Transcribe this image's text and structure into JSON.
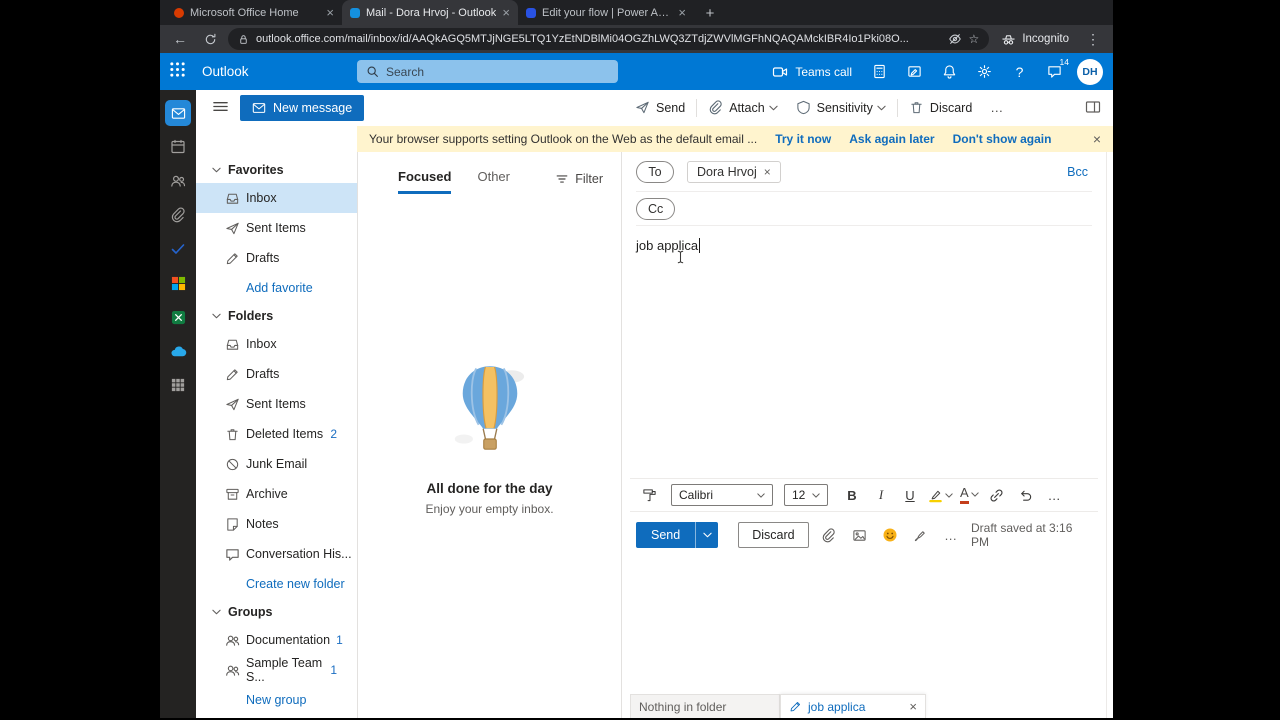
{
  "theme": {
    "accent": "#0078d4",
    "header_bg": "#0078d4",
    "banner_bg": "#fff4ce",
    "selected_row_bg": "#cde4f7",
    "chrome_bg": "#202124",
    "chrome_toolbar_bg": "#35363a",
    "rail_bg": "#242322",
    "link_blue": "#0f6cbd"
  },
  "glyphs": {
    "close": "×",
    "plus": "+",
    "back": "←",
    "menu_dots": "⋮",
    "ellipsis": "…",
    "help": "?",
    "bold": "B",
    "italic": "I",
    "underline": "U",
    "font_color": "A",
    "star": "☆"
  },
  "browser": {
    "tabs": [
      {
        "title": "Microsoft Office Home"
      },
      {
        "title": "Mail - Dora Hrvoj - Outlook"
      },
      {
        "title": "Edit your flow | Power Auto"
      }
    ],
    "active_tab_index": 1,
    "url": "outlook.office.com/mail/inbox/id/AAQkAGQ5MTJjNGE5LTQ1YzEtNDBlMi04OGZhLWQ3ZTdjZWVlMGFhNQAQAMckIBR4Io1Pki08O...",
    "incognito_label": "Incognito"
  },
  "header": {
    "app_name": "Outlook",
    "search_placeholder": "Search",
    "teams_call_label": "Teams call",
    "notification_count": "14",
    "avatar_initials": "DH"
  },
  "command_bar": {
    "new_message_label": "New message",
    "send_label": "Send",
    "attach_label": "Attach",
    "sensitivity_label": "Sensitivity",
    "discard_label": "Discard"
  },
  "banner": {
    "message": "Your browser supports setting Outlook on the Web as the default email ...",
    "try_now": "Try it now",
    "ask_later": "Ask again later",
    "dont_show": "Don't show again"
  },
  "sidebar": {
    "favorites_header": "Favorites",
    "favorites": [
      {
        "label": "Inbox"
      },
      {
        "label": "Sent Items"
      },
      {
        "label": "Drafts"
      },
      {
        "label": "Add favorite"
      }
    ],
    "folders_header": "Folders",
    "folders": [
      {
        "label": "Inbox"
      },
      {
        "label": "Drafts"
      },
      {
        "label": "Sent Items"
      },
      {
        "label": "Deleted Items",
        "count": "2"
      },
      {
        "label": "Junk Email"
      },
      {
        "label": "Archive"
      },
      {
        "label": "Notes"
      },
      {
        "label": "Conversation His..."
      },
      {
        "label": "Create new folder"
      }
    ],
    "groups_header": "Groups",
    "groups": [
      {
        "label": "Documentation",
        "count": "1"
      },
      {
        "label": "Sample Team S...",
        "count": "1"
      },
      {
        "label": "New group"
      }
    ]
  },
  "message_list": {
    "focused_tab": "Focused",
    "other_tab": "Other",
    "filter_label": "Filter",
    "empty_title": "All done for the day",
    "empty_subtitle": "Enjoy your empty inbox."
  },
  "compose": {
    "to_label": "To",
    "cc_label": "Cc",
    "bcc_label": "Bcc",
    "recipient_name": "Dora Hrvoj",
    "subject_value": "job applica",
    "font_name": "Calibri",
    "font_size": "12",
    "send_label": "Send",
    "discard_label": "Discard",
    "draft_status": "Draft saved at 3:16 PM"
  },
  "dock": {
    "status_text": "Nothing in folder",
    "draft_tab_label": "job applica"
  }
}
